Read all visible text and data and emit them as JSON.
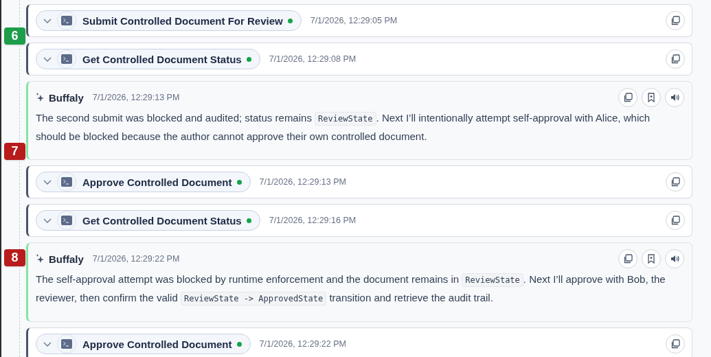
{
  "timeline": [
    {
      "kind": "tool",
      "title": "Submit Controlled Document For Review",
      "time": "7/1/2026, 12:29:05 PM",
      "succeeded": true,
      "expanded": false,
      "step": {
        "label": "6",
        "color": "#1e9e4a"
      }
    },
    {
      "kind": "tool",
      "title": "Get Controlled Document Status",
      "time": "7/1/2026, 12:29:08 PM",
      "succeeded": true,
      "expanded": false
    },
    {
      "kind": "assistant",
      "author": "Buffaly",
      "time": "7/1/2026, 12:29:13 PM",
      "step": {
        "label": "7",
        "color": "#b91c1c"
      },
      "message": [
        {
          "kind": "text",
          "text": "The second submit was blocked and audited; status remains "
        },
        {
          "kind": "code",
          "text": "ReviewState"
        },
        {
          "kind": "text",
          "text": ". Next I’ll intentionally attempt self-approval with Alice, which should be blocked because the author cannot approve their own controlled document."
        }
      ]
    },
    {
      "kind": "tool",
      "title": "Approve Controlled Document",
      "time": "7/1/2026, 12:29:13 PM",
      "succeeded": true,
      "expanded": false
    },
    {
      "kind": "tool",
      "title": "Get Controlled Document Status",
      "time": "7/1/2026, 12:29:16 PM",
      "succeeded": true,
      "expanded": false
    },
    {
      "kind": "assistant",
      "author": "Buffaly",
      "time": "7/1/2026, 12:29:22 PM",
      "step": {
        "label": "8",
        "color": "#b91c1c"
      },
      "message": [
        {
          "kind": "text",
          "text": "The self-approval attempt was blocked by runtime enforcement and the document remains in "
        },
        {
          "kind": "code",
          "text": "ReviewState"
        },
        {
          "kind": "text",
          "text": ". Next I’ll approve with Bob, the reviewer, then confirm the valid "
        },
        {
          "kind": "code",
          "text": "ReviewState -> ApprovedState"
        },
        {
          "kind": "text",
          "text": " transition and retrieve the audit trail."
        }
      ]
    },
    {
      "kind": "tool",
      "title": "Approve Controlled Document",
      "time": "7/1/2026, 12:29:22 PM",
      "succeeded": true,
      "expanded": false
    }
  ]
}
